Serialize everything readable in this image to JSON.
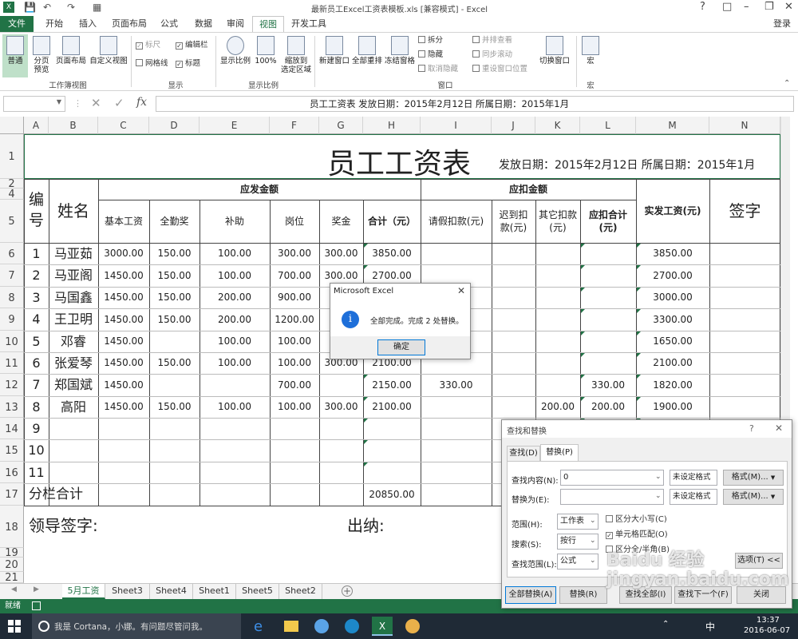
{
  "window": {
    "title": "最新员工Excel工资表模板.xls  [兼容模式] - Excel",
    "signin": "登录"
  },
  "tabs": [
    "文件",
    "开始",
    "插入",
    "页面布局",
    "公式",
    "数据",
    "审阅",
    "视图",
    "开发工具"
  ],
  "ribbon": {
    "workbook_views": {
      "normal": "普通",
      "page_break": "分页\n预览",
      "page_layout": "页面布局",
      "custom": "自定义视图",
      "label": "工作簿视图"
    },
    "show": {
      "ruler": "标尺",
      "formula_bar": "编辑栏",
      "gridlines": "网格线",
      "headings": "标题",
      "label": "显示"
    },
    "zoom": {
      "zoom": "显示比例",
      "zoom100": "100%",
      "zoom_sel": "缩放到\n选定区域",
      "label": "显示比例"
    },
    "window": {
      "new": "新建窗口",
      "arrange": "全部重排",
      "freeze": "冻结窗格",
      "split": "拆分",
      "hide": "隐藏",
      "unhide": "取消隐藏",
      "side": "并排查看",
      "sync": "同步滚动",
      "reset": "重设窗口位置",
      "switch": "切换窗口",
      "label": "窗口"
    },
    "macro": {
      "macro": "宏",
      "label": "宏"
    }
  },
  "formula": {
    "content": "员工工资表    发放日期：2015年2月12日  所属日期：2015年1月"
  },
  "columns": [
    "A",
    "B",
    "C",
    "D",
    "E",
    "F",
    "G",
    "H",
    "I",
    "J",
    "K",
    "L",
    "M",
    "N"
  ],
  "rows": [
    "1",
    "2",
    "4",
    "5",
    "6",
    "7",
    "8",
    "9",
    "10",
    "11",
    "12",
    "13",
    "14",
    "15",
    "16",
    "17",
    "18",
    "19",
    "20",
    "21"
  ],
  "sheet": {
    "title": "员工工资表",
    "subtitle": "发放日期：2015年2月12日 所属日期：2015年1月",
    "h_id": "编\n号",
    "h_name": "姓名",
    "h_pay": "应发金额",
    "h_deduct": "应扣金额",
    "h_base": "基本工资",
    "h_attend": "全勤奖",
    "h_subsidy": "补助",
    "h_post": "岗位",
    "h_bonus": "奖金",
    "h_total": "合计（元）",
    "h_leave": "请假扣款(元)",
    "h_late": "迟到扣\n款(元)",
    "h_other": "其它扣款\n(元)",
    "h_dtotal": "应扣合计\n(元)",
    "h_net": "实发工资(元)",
    "h_sign": "签字",
    "data": [
      [
        "1",
        "马亚茹",
        "3000.00",
        "150.00",
        "100.00",
        "300.00",
        "300.00",
        "3850.00",
        "",
        "",
        "",
        "",
        "3850.00"
      ],
      [
        "2",
        "马亚阁",
        "1450.00",
        "150.00",
        "100.00",
        "700.00",
        "300.00",
        "2700.00",
        "",
        "",
        "",
        "",
        "2700.00"
      ],
      [
        "3",
        "马国鑫",
        "1450.00",
        "150.00",
        "200.00",
        "900.00",
        "3",
        "",
        "",
        "",
        "",
        "",
        "3000.00"
      ],
      [
        "4",
        "王卫明",
        "1450.00",
        "150.00",
        "200.00",
        "1200.00",
        "3",
        "",
        "",
        "",
        "",
        "",
        "3300.00"
      ],
      [
        "5",
        "邓睿",
        "1450.00",
        "",
        "100.00",
        "100.00",
        "",
        "",
        "",
        "",
        "",
        "",
        "1650.00"
      ],
      [
        "6",
        "张爱琴",
        "1450.00",
        "150.00",
        "100.00",
        "100.00",
        "300.00",
        "2100.00",
        "",
        "",
        "",
        "",
        "2100.00"
      ],
      [
        "7",
        "郑国斌",
        "1450.00",
        "",
        "",
        "700.00",
        "",
        "2150.00",
        "330.00",
        "",
        "",
        "330.00",
        "1820.00"
      ],
      [
        "8",
        "高阳",
        "1450.00",
        "150.00",
        "100.00",
        "100.00",
        "300.00",
        "2100.00",
        "",
        "",
        "200.00",
        "200.00",
        "1900.00"
      ],
      [
        "9",
        "",
        "",
        "",
        "",
        "",
        "",
        "",
        "",
        "",
        "",
        "",
        ""
      ],
      [
        "10",
        "",
        "",
        "",
        "",
        "",
        "",
        "",
        "",
        "",
        "",
        "",
        ""
      ],
      [
        "11",
        "",
        "",
        "",
        "",
        "",
        "",
        "",
        "",
        "",
        "",
        "",
        ""
      ]
    ],
    "subtotal_label": "分栏合计",
    "subtotal_value": "20850.00",
    "leader": "领导签字:",
    "cashier": "出纳:"
  },
  "sheet_tabs": [
    "5月工资",
    "Sheet3",
    "Sheet4",
    "Sheet1",
    "Sheet5",
    "Sheet2"
  ],
  "status": {
    "ready": "就绪"
  },
  "msgbox": {
    "title": "Microsoft Excel",
    "message": "全部完成。完成 2 处替换。",
    "ok": "确定"
  },
  "find": {
    "title": "查找和替换",
    "tab_find": "查找(D)",
    "tab_replace": "替换(P)",
    "find_label": "查找内容(N):",
    "find_value": "0",
    "replace_label": "替换为(E):",
    "replace_value": "",
    "noformat1": "未设定格式",
    "noformat2": "未设定格式",
    "format1": "格式(M)...",
    "format2": "格式(M)...",
    "scope_label": "范围(H):",
    "scope": "工作表",
    "search_label": "搜索(S):",
    "search": "按行",
    "lookin_label": "查找范围(L):",
    "lookin": "公式",
    "case": "区分大小写(C)",
    "whole": "单元格匹配(O)",
    "width": "区分全/半角(B)",
    "options": "选项(T) <<",
    "replace_all": "全部替换(A)",
    "replace": "替换(R)",
    "find_all": "查找全部(I)",
    "find_next": "查找下一个(F)",
    "close": "关闭"
  },
  "taskbar": {
    "cortana": "我是 Cortana，小娜。有问题尽管问我。",
    "time": "13:37",
    "date": "2016-06-07",
    "ime": "中"
  },
  "watermark": "Baidu 经验\njingyan.baidu.com",
  "colors": {
    "excel_green": "#217346",
    "taskbar": "#1f2a36"
  }
}
